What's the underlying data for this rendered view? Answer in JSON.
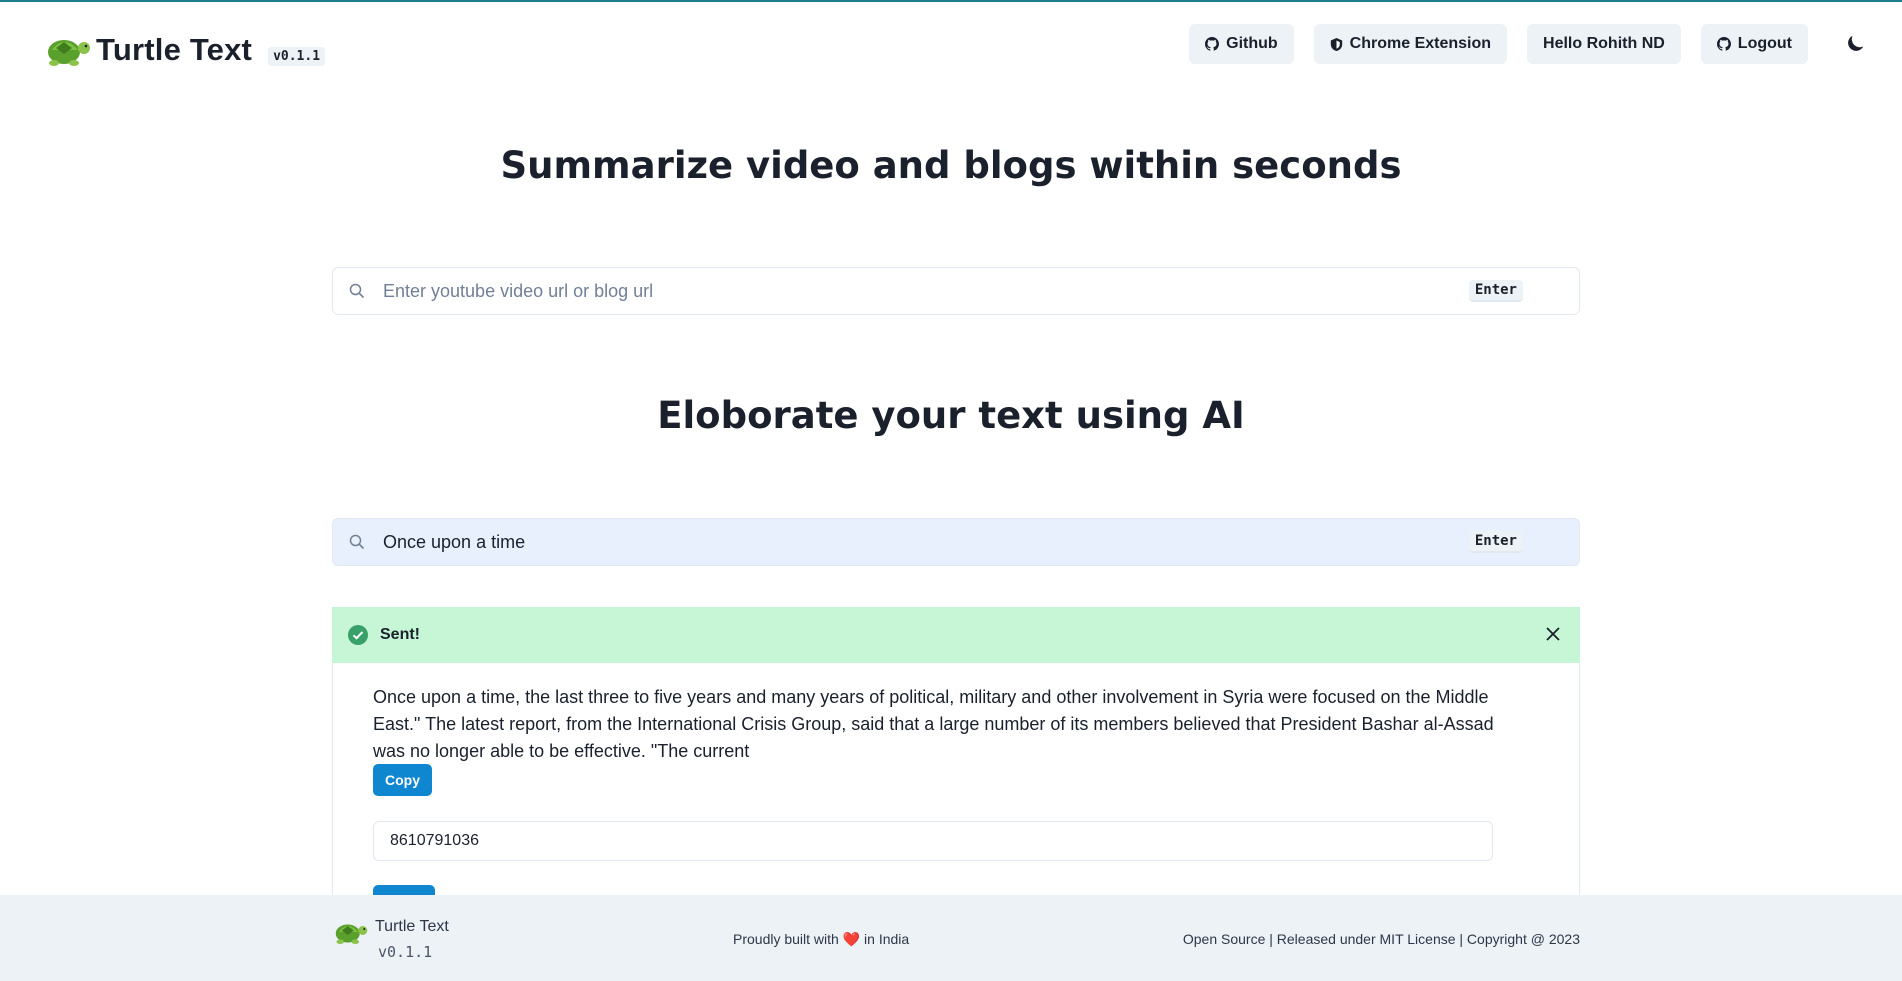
{
  "header": {
    "brand_name": "Turtle Text",
    "version": "v0.1.1",
    "nav": {
      "github": "Github",
      "chrome_extension": "Chrome Extension",
      "greeting": "Hello Rohith ND",
      "logout": "Logout"
    }
  },
  "summarize": {
    "heading": "Summarize video and blogs within seconds",
    "input_value": "",
    "placeholder": "Enter youtube video url or blog url",
    "enter_key": "Enter"
  },
  "elaborate": {
    "heading": "Eloborate your text using AI",
    "input_value": "Once upon a time",
    "placeholder": "",
    "enter_key": "Enter"
  },
  "alert": {
    "title": "Sent!",
    "status_color": "#38a169"
  },
  "result": {
    "text": "Once upon a time, the last three to five years and many years of political, military and other involvement in Syria were focused on the Middle East.\" The latest report, from the International Crisis Group, said that a large number of its members believed that President Bashar al-Assad was no longer able to be effective. \"The current",
    "copy_label": "Copy",
    "phone_value": "8610791036"
  },
  "footer": {
    "brand_name": "Turtle Text",
    "version": "v0.1.1",
    "built_prefix": "Proudly built with",
    "built_suffix": "in India",
    "license": "Open Source | Released under MIT License | Copyright @ 2023"
  },
  "colors": {
    "accent": "#0f86d0",
    "alert_bg": "#c6f6d5",
    "nav_bg": "#edf2f7",
    "heart": "#e53e3e"
  }
}
